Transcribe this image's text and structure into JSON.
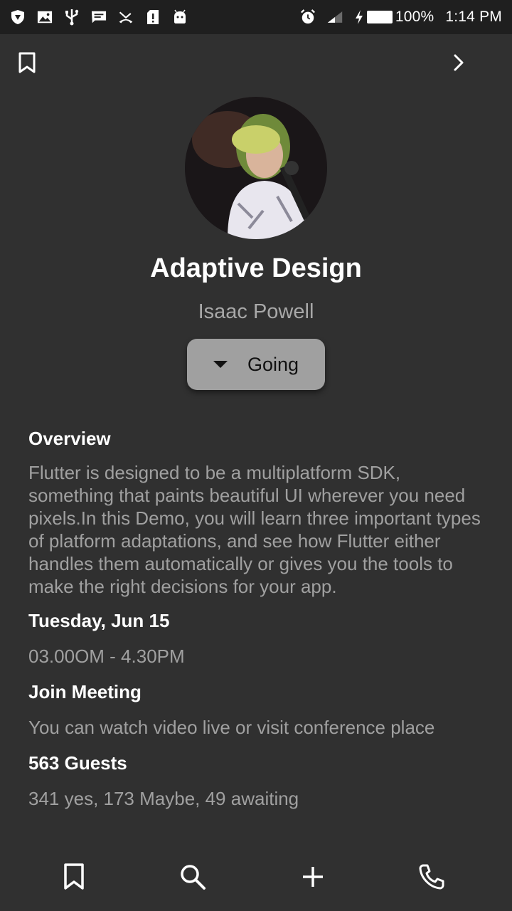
{
  "status_bar": {
    "battery": "100%",
    "time": "1:14 PM",
    "left_icons": [
      "shield-icon",
      "image-icon",
      "usb-icon",
      "message-icon",
      "missed-call-icon",
      "sim-alert-icon",
      "android-icon"
    ],
    "right_icons": [
      "alarm-icon",
      "signal-icon",
      "charging-icon",
      "battery-icon"
    ]
  },
  "app_bar": {
    "left_icon": "bookmark-icon",
    "right_icon": "chevron-right-icon"
  },
  "event": {
    "title": "Adaptive Design",
    "speaker": "Isaac Powell",
    "rsvp_label": "Going"
  },
  "overview": {
    "heading": "Overview",
    "text": "Flutter is designed to be a multiplatform SDK, something that paints beautiful UI wherever you need pixels.In this Demo, you will learn three important types of platform adaptations, and see how Flutter either handles them automatically or gives you the tools to make the right decisions for your app."
  },
  "schedule": {
    "date": "Tuesday, Jun 15",
    "time": "03.00OM - 4.30PM"
  },
  "meeting": {
    "heading": "Join Meeting",
    "text": "You can watch video live or visit conference place"
  },
  "guests": {
    "heading": "563 Guests",
    "text": "341 yes, 173 Maybe, 49 awaiting"
  },
  "bottom_nav": {
    "icons": [
      "bookmark-icon",
      "search-icon",
      "add-icon",
      "phone-icon"
    ]
  },
  "colors": {
    "background": "#303030",
    "status_bar": "#1f1f1f",
    "button": "#a0a0a0",
    "secondary_text": "#a0a0a0"
  }
}
